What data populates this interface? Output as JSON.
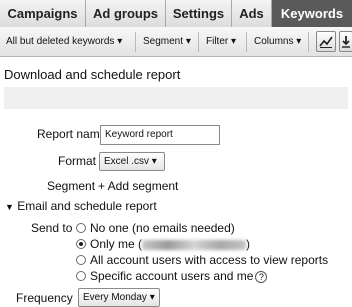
{
  "tabs": [
    "Campaigns",
    "Ad groups",
    "Settings",
    "Ads",
    "Keywords"
  ],
  "active_tab": "Keywords",
  "toolbar": {
    "filter_view": "All but deleted keywords",
    "segment": "Segment",
    "filter": "Filter",
    "columns": "Columns",
    "chart_icon": "line-chart-icon",
    "download_icon": "download-icon"
  },
  "panel": {
    "title": "Download and schedule report",
    "report_name_label": "Report name",
    "report_name_value": "Keyword report",
    "format_label": "Format",
    "format_value": "Excel .csv",
    "segment_label": "Segment",
    "add_segment": "+ Add segment",
    "email_section": "Email and schedule report",
    "send_to_label": "Send to",
    "send_options": {
      "no_one": "No one (no emails needed)",
      "only_me_prefix": "Only me (",
      "only_me_suffix": ")",
      "all_users": "All account users with access to view reports",
      "specific": "Specific account users and me"
    },
    "selected_option": "only_me",
    "frequency_label": "Frequency",
    "frequency_value": "Every Monday"
  }
}
